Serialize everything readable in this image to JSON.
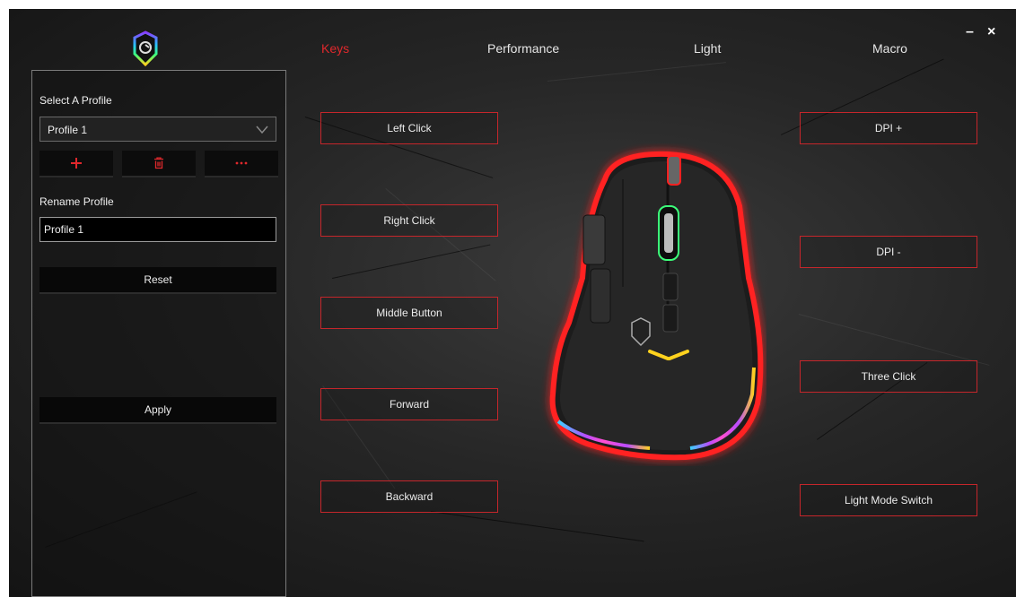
{
  "tabs": [
    {
      "label": "Keys"
    },
    {
      "label": "Performance"
    },
    {
      "label": "Light"
    },
    {
      "label": "Macro"
    }
  ],
  "window_controls": {
    "minimize": "–",
    "close": "×"
  },
  "sidebar": {
    "select_profile_label": "Select A Profile",
    "selected_profile": "Profile 1",
    "rename_label": "Rename Profile",
    "rename_value": "Profile 1",
    "reset_label": "Reset",
    "apply_label": "Apply"
  },
  "keys_left": [
    {
      "label": "Left Click"
    },
    {
      "label": "Right Click"
    },
    {
      "label": "Middle Button"
    },
    {
      "label": "Forward"
    },
    {
      "label": "Backward"
    }
  ],
  "keys_right": [
    {
      "label": "DPI +"
    },
    {
      "label": "DPI -"
    },
    {
      "label": "Three Click"
    },
    {
      "label": "Light Mode Switch"
    }
  ],
  "colors": {
    "accent": "#e0282c",
    "panel_border": "#7a7a7a",
    "button_border": "#c5262b"
  },
  "icons": {
    "add": "plus-icon",
    "delete": "trash-icon",
    "more": "more-icon",
    "logo": "brand-shield-logo"
  }
}
